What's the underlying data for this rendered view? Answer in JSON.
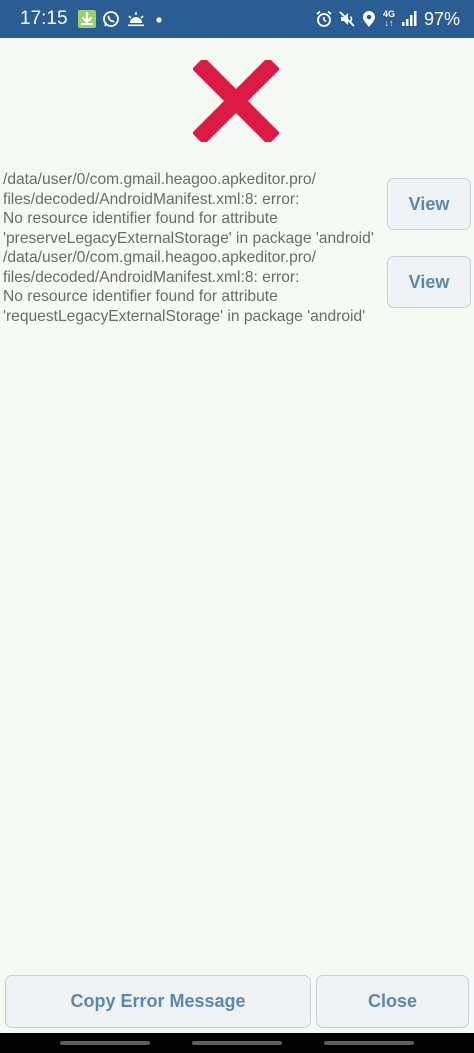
{
  "status_bar": {
    "time": "17:15",
    "left_icons": [
      "android-notification-icon",
      "whatsapp-icon",
      "weather-icon",
      "dot-icon"
    ],
    "right_icons": [
      "alarm-icon",
      "mute-icon",
      "location-icon",
      "network-4g-icon",
      "signal-icon"
    ],
    "network_label_top": "4G",
    "network_label_bottom": "↓↑",
    "battery": "97%"
  },
  "header": {
    "icon": "error-cross-icon",
    "icon_color": "#dc1a43"
  },
  "errors": [
    {
      "message": "/data/user/0/com.gmail.heagoo.apkeditor.pro/\nfiles/decoded/AndroidManifest.xml:8: error:\nNo resource identifier found for attribute\n'preserveLegacyExternalStorage' in package 'android'",
      "action_label": "View"
    },
    {
      "message": "/data/user/0/com.gmail.heagoo.apkeditor.pro/\nfiles/decoded/AndroidManifest.xml:8: error:\nNo resource identifier found for attribute\n'requestLegacyExternalStorage' in package 'android'",
      "action_label": "View"
    }
  ],
  "footer": {
    "copy_label": "Copy Error Message",
    "close_label": "Close"
  },
  "colors": {
    "status_bar": "#2a5d93",
    "background": "#f5faf5",
    "button_text": "#5b88ad",
    "error_text": "#6b6b6b"
  }
}
